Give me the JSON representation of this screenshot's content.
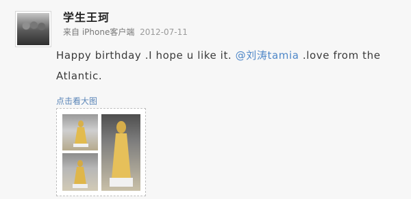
{
  "user": {
    "name": "学生王珂"
  },
  "meta": {
    "source": "来自 iPhone客户端",
    "date": "2012-07-11"
  },
  "post": {
    "text_before": "Happy birthday .I hope u like it. ",
    "mention": "@刘涛tamia",
    "text_after": " .love from the Atlantic."
  },
  "link": {
    "view_large": "点击看大图"
  }
}
